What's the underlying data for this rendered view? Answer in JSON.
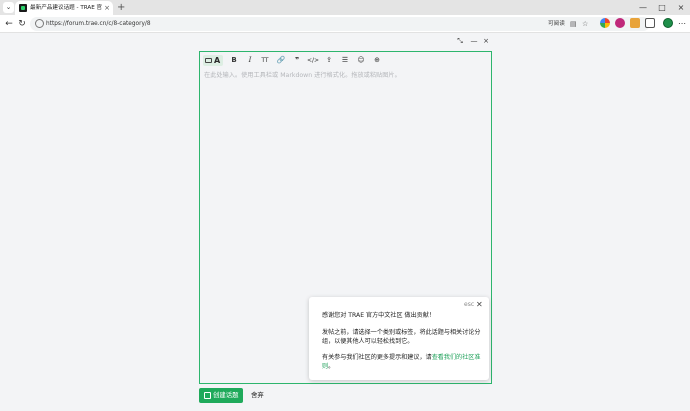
{
  "browser": {
    "tab_title": "最新产品建议话题 - TRAE 官方中文社区",
    "url": "https://forum.trae.cn/c/8-category/8",
    "read_aloud": "可阅读",
    "new_tab": "+",
    "tab_menu_icon": "chevron-down-icon",
    "win_min": "—",
    "win_max": "□",
    "win_close": "×",
    "nav_back": "←",
    "nav_refresh": "↻",
    "menu": "⋯"
  },
  "composer": {
    "collapse": "⤡",
    "minimize": "—",
    "close": "×",
    "placeholder": "在此处输入。使用工具栏或 Markdown 进行格式化。拖放或粘贴图片。",
    "toolbar": {
      "bold": "B",
      "italic": "I",
      "heading": "TT",
      "link": "🔗",
      "quote": "❞",
      "code": "</>",
      "upload": "⇪",
      "list": "☰",
      "emoji": "☺",
      "more": "⊕"
    },
    "create_label": "创建话题",
    "discard_label": "舍弃"
  },
  "popup": {
    "esc": "esc",
    "close": "✕",
    "line1": "感谢您对 TRAE 官方中文社区 做出贡献！",
    "line2": "发帖之前，请选择一个类别或标签，将此话题与相关讨论分组，以便其他人可以轻松找到它。",
    "line3_prefix": "有关参与我们社区的更多提示和建议，请",
    "line3_link": "查看我们的社区准则",
    "line3_suffix": "。"
  },
  "colors": {
    "accent": "#1faa5b",
    "editor_border": "#2db56d",
    "placeholder": "#b4b6ba"
  }
}
